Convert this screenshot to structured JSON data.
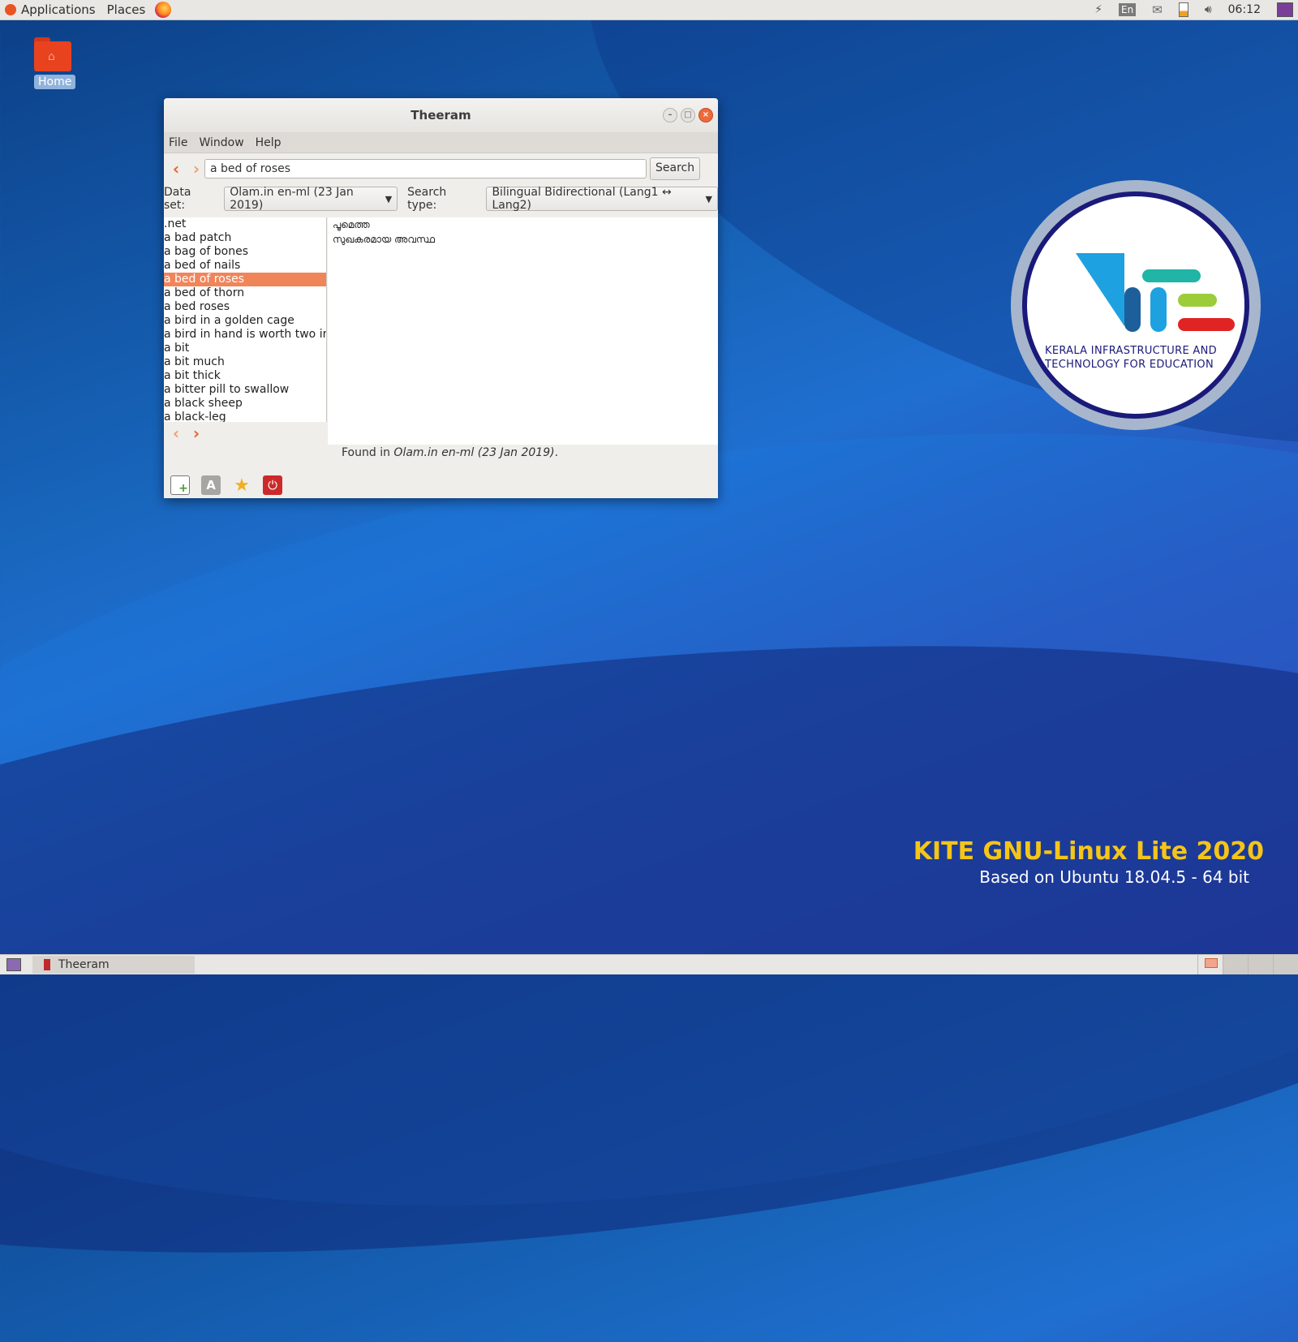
{
  "top_panel": {
    "applications": "Applications",
    "places": "Places",
    "keyboard_layout": "En",
    "clock": "06:12"
  },
  "desktop": {
    "home_label": "Home"
  },
  "window": {
    "title": "Theeram",
    "menu": [
      "File",
      "Window",
      "Help"
    ],
    "search_value": "a bed of roses",
    "search_button": "Search",
    "dataset_label": "Data set:",
    "dataset_value": "Olam.in en-ml (23 Jan 2019)",
    "search_type_label": "Search type:",
    "search_type_value": "Bilingual Bidirectional (Lang1 ↔ Lang2)",
    "word_list": [
      ".net",
      "a bad patch",
      "a bag of bones",
      "a bed of nails",
      "a bed of roses",
      "a bed of thorn",
      "a bed roses",
      "a bird in a golden cage",
      "a bird in hand is worth  two in t",
      "a bit",
      "a bit much",
      "a bit thick",
      "a bitter pill to swallow",
      "a black sheep",
      "a black-leg"
    ],
    "selected_index": 4,
    "results": [
      "പൂമെത്ത",
      "സുഖകരമായ അവസ്ഥ"
    ],
    "status_prefix": "Found in ",
    "status_source": "Olam.in en-ml (23 Jan 2019)",
    "status_suffix": "."
  },
  "branding": {
    "kite_line1": "KERALA INFRASTRUCTURE AND",
    "kite_line2": "TECHNOLOGY FOR EDUCATION",
    "os_name": "KITE GNU-Linux Lite 2020",
    "os_base": "Based on Ubuntu 18.04.5 - 64 bit"
  },
  "bottom_panel": {
    "task_label": "Theeram"
  },
  "colors": {
    "accent": "#f1855a",
    "close": "#ee6a3c",
    "brand_yellow": "#f5c518"
  }
}
